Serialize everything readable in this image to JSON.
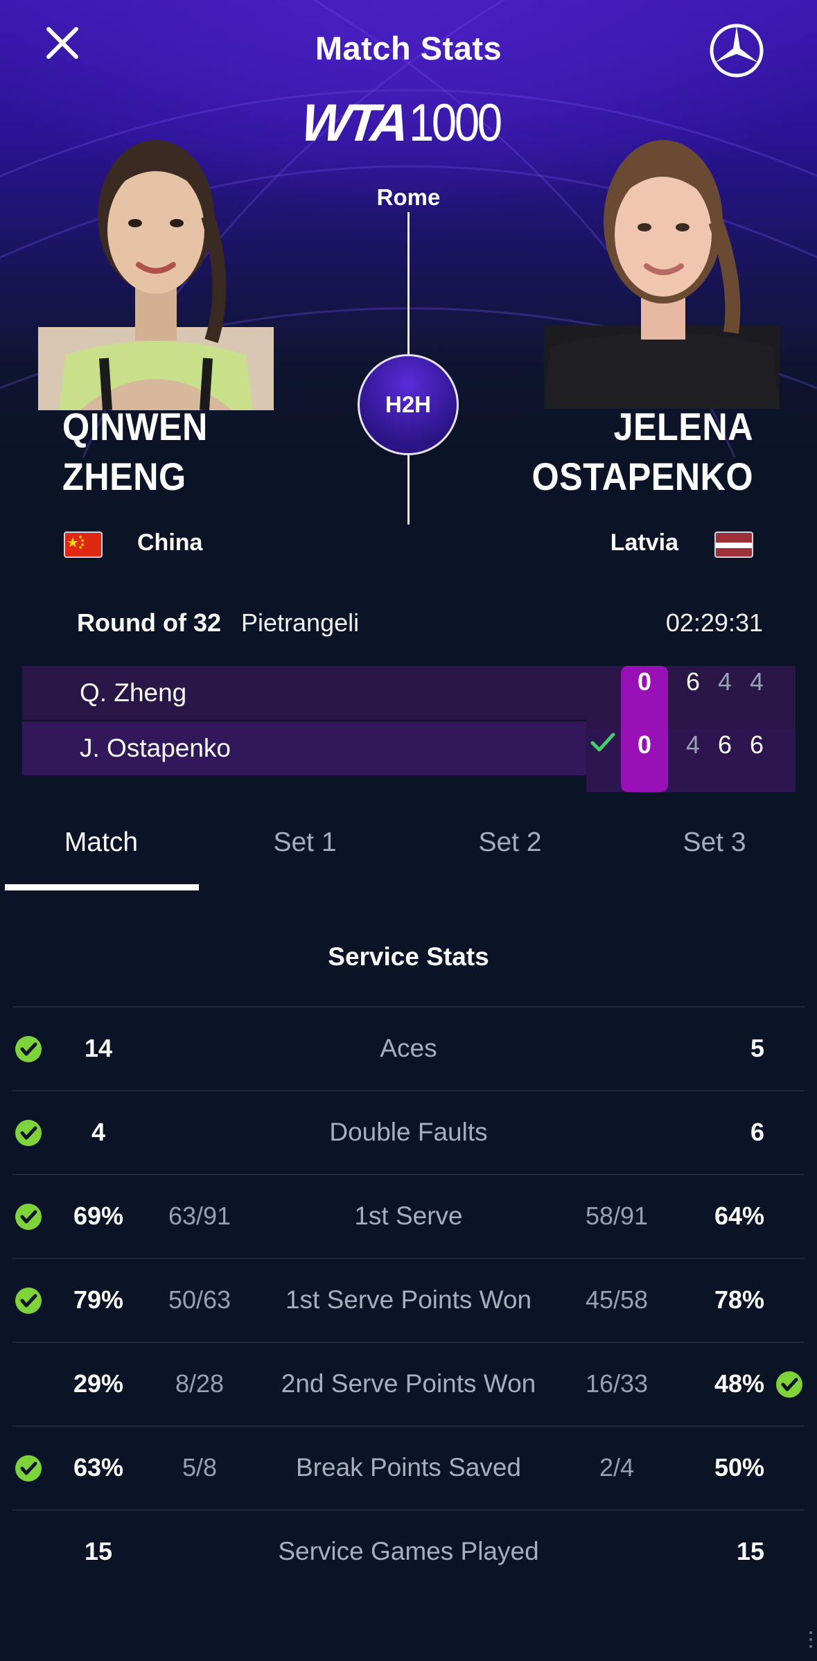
{
  "header": {
    "title": "Match Stats",
    "tournament_level": "1000",
    "tournament_brand": "WTA",
    "city": "Rome",
    "h2h_label": "H2H"
  },
  "players": [
    {
      "first": "QINWEN",
      "last": "ZHENG",
      "country": "China",
      "short": "Q. Zheng"
    },
    {
      "first": "JELENA",
      "last": "OSTAPENKO",
      "country": "Latvia",
      "short": "J. Ostapenko"
    }
  ],
  "match": {
    "round": "Round of 32",
    "court": "Pietrangeli",
    "duration": "02:29:31",
    "scores": [
      {
        "game": "0",
        "sets": [
          "6",
          "4",
          "4"
        ]
      },
      {
        "game": "0",
        "sets": [
          "4",
          "6",
          "6"
        ]
      }
    ]
  },
  "tabs": [
    "Match",
    "Set 1",
    "Set 2",
    "Set 3"
  ],
  "stats": {
    "section": "Service Stats",
    "rows": [
      {
        "label": "Aces",
        "left": "14",
        "left_frac": "",
        "right": "5",
        "right_frac": "",
        "leader": "left"
      },
      {
        "label": "Double Faults",
        "left": "4",
        "left_frac": "",
        "right": "6",
        "right_frac": "",
        "leader": "left"
      },
      {
        "label": "1st Serve",
        "left": "69%",
        "left_frac": "63/91",
        "right": "64%",
        "right_frac": "58/91",
        "leader": "left"
      },
      {
        "label": "1st Serve Points Won",
        "left": "79%",
        "left_frac": "50/63",
        "right": "78%",
        "right_frac": "45/58",
        "leader": "left"
      },
      {
        "label": "2nd Serve Points Won",
        "left": "29%",
        "left_frac": "8/28",
        "right": "48%",
        "right_frac": "16/33",
        "leader": "right"
      },
      {
        "label": "Break Points Saved",
        "left": "63%",
        "left_frac": "5/8",
        "right": "50%",
        "right_frac": "2/4",
        "leader": "left"
      },
      {
        "label": "Service Games Played",
        "left": "15",
        "left_frac": "",
        "right": "15",
        "right_frac": "",
        "leader": "none"
      }
    ]
  },
  "colors": {
    "accent_magenta": "#9a10b7",
    "lead_green": "#7fd33a",
    "background": "#0b1326"
  },
  "icons": [
    "close-icon",
    "mercedes-logo-icon",
    "check-icon",
    "lead-check-icon"
  ]
}
